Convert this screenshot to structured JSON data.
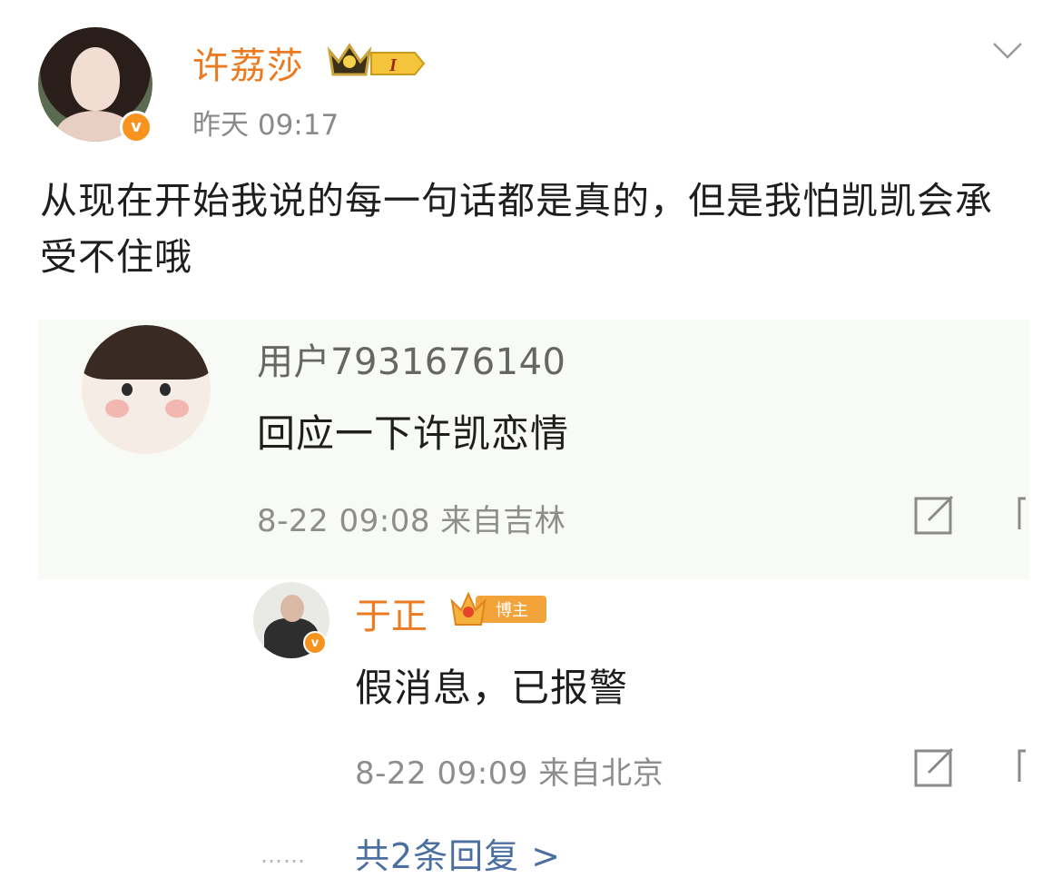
{
  "post": {
    "author": {
      "name": "许荔莎",
      "avatar": "user-avatar",
      "verified_icon": "v",
      "level_badge": "I"
    },
    "time": "昨天 09:17",
    "text": "从现在开始我说的每一句话都是真的，但是我怕凯凯会承受不住哦"
  },
  "comment": {
    "user": "用户7931676140",
    "text": "回应一下许凯恋情",
    "meta": "8-22 09:08 来自吉林"
  },
  "reply": {
    "user": "于正",
    "verified_icon": "v",
    "badge_label": "博主",
    "text": "假消息，已报警",
    "meta": "8-22 09:09 来自北京"
  },
  "more": {
    "dots": "……",
    "label": "共2条回复 >"
  },
  "colors": {
    "accent_orange": "#eb7a21",
    "link_blue": "#4a6fa0",
    "meta_gray": "#8d8d8d",
    "card_bg": "#f8faf5"
  }
}
